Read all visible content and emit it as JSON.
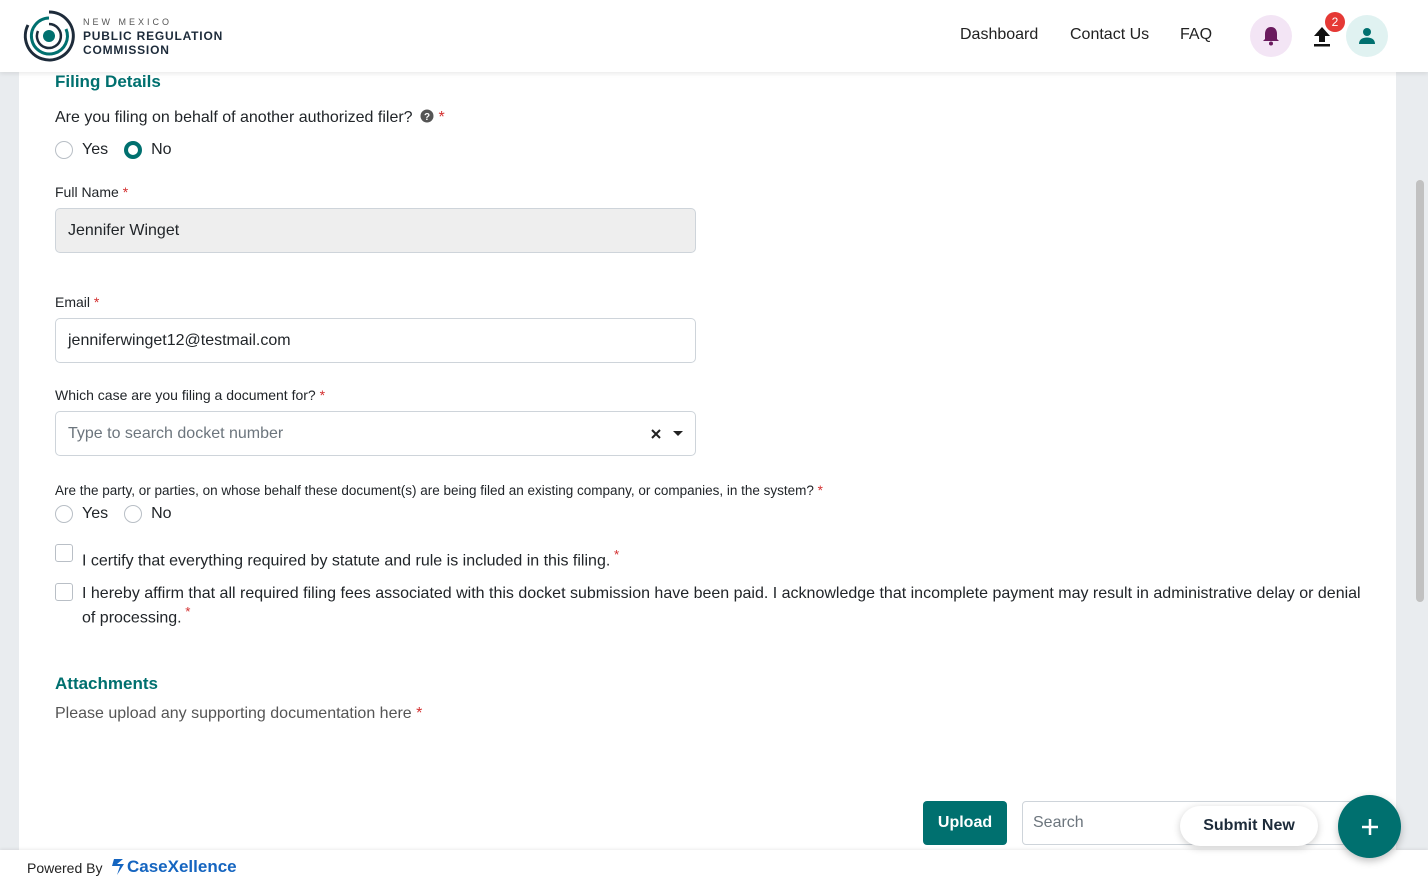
{
  "header": {
    "logo_top": "NEW MEXICO",
    "logo_line1": "PUBLIC REGULATION",
    "logo_line2": "COMMISSION",
    "nav": [
      "Dashboard",
      "Contact Us",
      "FAQ"
    ],
    "upload_badge": "2",
    "icons": [
      "bell-icon",
      "upload-icon",
      "user-icon"
    ]
  },
  "filing": {
    "title": "Filing Details",
    "behalf_question": "Are you filing on behalf of another authorized filer?",
    "behalf_options": [
      "Yes",
      "No"
    ],
    "behalf_selected": "No",
    "full_name_label": "Full Name",
    "full_name_value": "Jennifer Winget",
    "email_label": "Email",
    "email_value": "jenniferwinget12@testmail.com",
    "case_label": "Which case are you filing a document for?",
    "case_placeholder": "Type to search docket number",
    "party_question": "Are the party, or parties, on whose behalf these document(s) are being filed an existing company, or companies, in the system?",
    "party_options": [
      "Yes",
      "No"
    ],
    "certify_text": "I certify that everything required by statute and rule is included in this filing.",
    "affirm_text": "I hereby affirm that all required filing fees associated with this docket submission have been paid. I acknowledge that incomplete payment may result in administrative delay or denial of processing."
  },
  "attachments": {
    "title": "Attachments",
    "subtitle": "Please upload any supporting documentation here",
    "upload_label": "Upload",
    "search_placeholder": "Search"
  },
  "submit_new_label": "Submit New",
  "footer": {
    "powered_by": "Powered By",
    "brand": "CaseXellence"
  },
  "colors": {
    "accent": "#00706f",
    "required": "#d32f2f",
    "badge": "#e53935",
    "bell_bg": "#f3e5f5",
    "user_bg": "#e0f2f1"
  }
}
